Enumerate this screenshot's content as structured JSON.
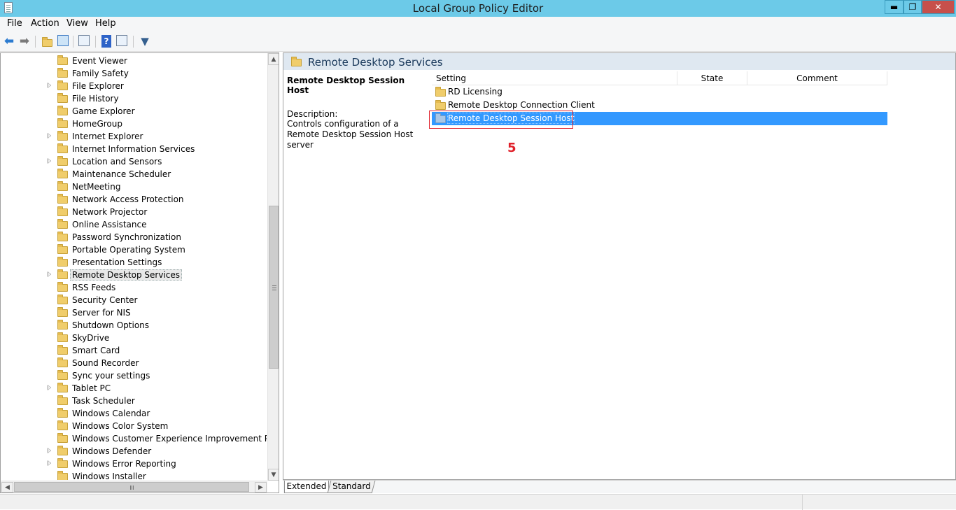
{
  "window": {
    "title": "Local Group Policy Editor",
    "min_icon": "minimize-icon",
    "max_icon": "restore-icon",
    "close_icon": "close-icon",
    "min_glyph": "▬",
    "max_glyph": "❐",
    "close_glyph": "✕"
  },
  "menu": {
    "file": "File",
    "action": "Action",
    "view": "View",
    "help": "Help"
  },
  "toolbar": {
    "back": "back-arrow-icon",
    "forward": "forward-arrow-icon",
    "up": "up-one-level-icon",
    "show_hide_tree": "show-hide-console-tree-icon",
    "export": "export-list-icon",
    "help": "help-icon",
    "action_pane": "show-hide-action-pane-icon",
    "filter": "filter-icon"
  },
  "tree": {
    "items": [
      {
        "label": "Event Viewer",
        "expandable": false
      },
      {
        "label": "Family Safety",
        "expandable": false
      },
      {
        "label": "File Explorer",
        "expandable": true
      },
      {
        "label": "File History",
        "expandable": false
      },
      {
        "label": "Game Explorer",
        "expandable": false
      },
      {
        "label": "HomeGroup",
        "expandable": false
      },
      {
        "label": "Internet Explorer",
        "expandable": true
      },
      {
        "label": "Internet Information Services",
        "expandable": false
      },
      {
        "label": "Location and Sensors",
        "expandable": true
      },
      {
        "label": "Maintenance Scheduler",
        "expandable": false
      },
      {
        "label": "NetMeeting",
        "expandable": false
      },
      {
        "label": "Network Access Protection",
        "expandable": false
      },
      {
        "label": "Network Projector",
        "expandable": false
      },
      {
        "label": "Online Assistance",
        "expandable": false
      },
      {
        "label": "Password Synchronization",
        "expandable": false
      },
      {
        "label": "Portable Operating System",
        "expandable": false
      },
      {
        "label": "Presentation Settings",
        "expandable": false
      },
      {
        "label": "Remote Desktop Services",
        "expandable": true,
        "selected": true
      },
      {
        "label": "RSS Feeds",
        "expandable": false
      },
      {
        "label": "Security Center",
        "expandable": false
      },
      {
        "label": "Server for NIS",
        "expandable": false
      },
      {
        "label": "Shutdown Options",
        "expandable": false
      },
      {
        "label": "SkyDrive",
        "expandable": false
      },
      {
        "label": "Smart Card",
        "expandable": false
      },
      {
        "label": "Sound Recorder",
        "expandable": false
      },
      {
        "label": "Sync your settings",
        "expandable": false
      },
      {
        "label": "Tablet PC",
        "expandable": true
      },
      {
        "label": "Task Scheduler",
        "expandable": false
      },
      {
        "label": "Windows Calendar",
        "expandable": false
      },
      {
        "label": "Windows Color System",
        "expandable": false
      },
      {
        "label": "Windows Customer Experience Improvement Program",
        "expandable": false
      },
      {
        "label": "Windows Defender",
        "expandable": true
      },
      {
        "label": "Windows Error Reporting",
        "expandable": true
      },
      {
        "label": "Windows Installer",
        "expandable": false
      }
    ]
  },
  "details": {
    "header": "Remote Desktop Services",
    "selected_setting": "Remote Desktop Session Host",
    "description_label": "Description:",
    "description_text": "Controls configuration of a Remote Desktop Session Host server",
    "columns": [
      "Setting",
      "State",
      "Comment"
    ],
    "rows": [
      {
        "label": "RD Licensing",
        "selected": false
      },
      {
        "label": "Remote Desktop Connection Client",
        "selected": false
      },
      {
        "label": "Remote Desktop Session Host",
        "selected": true
      }
    ],
    "annotation_number": "5",
    "annotation_color": "#e0202a",
    "selection_color": "#3399ff"
  },
  "tabs": {
    "extended": "Extended",
    "standard": "Standard"
  }
}
